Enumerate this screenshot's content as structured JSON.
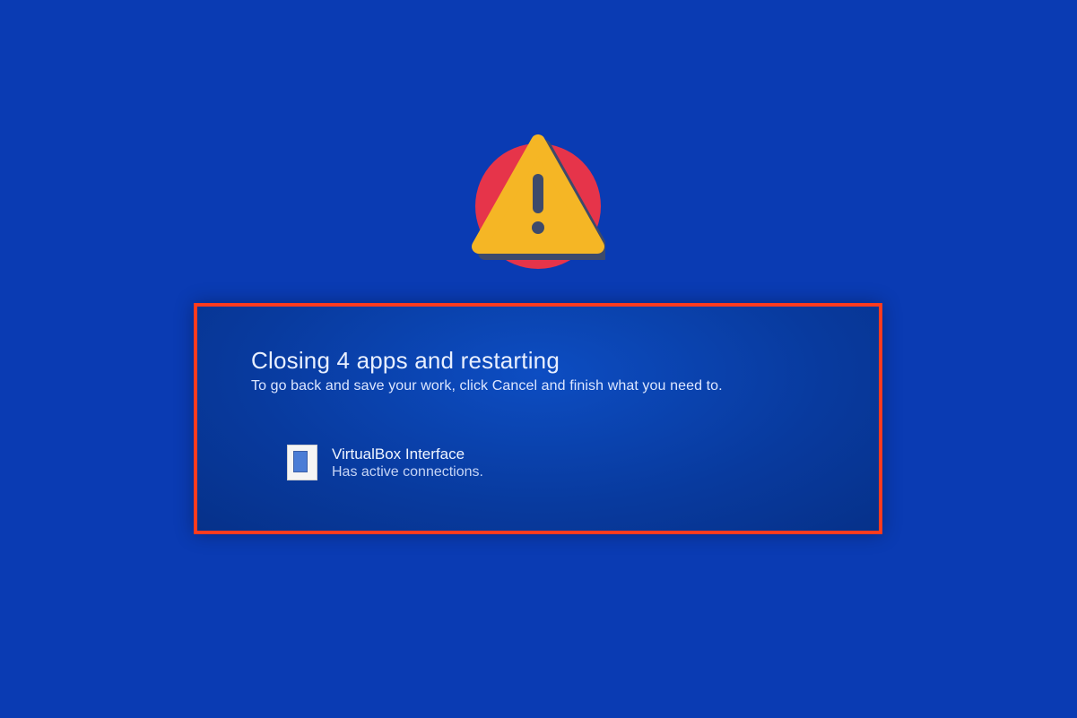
{
  "dialog": {
    "title": "Closing 4 apps and restarting",
    "subtitle": "To go back and save your work, click Cancel and finish what you need to.",
    "app": {
      "name": "VirtualBox Interface",
      "status": "Has active connections."
    }
  },
  "colors": {
    "background": "#0a3bb3",
    "highlight_border": "#ff3b1f",
    "warning_red": "#e6344a",
    "warning_yellow": "#f5b625"
  }
}
